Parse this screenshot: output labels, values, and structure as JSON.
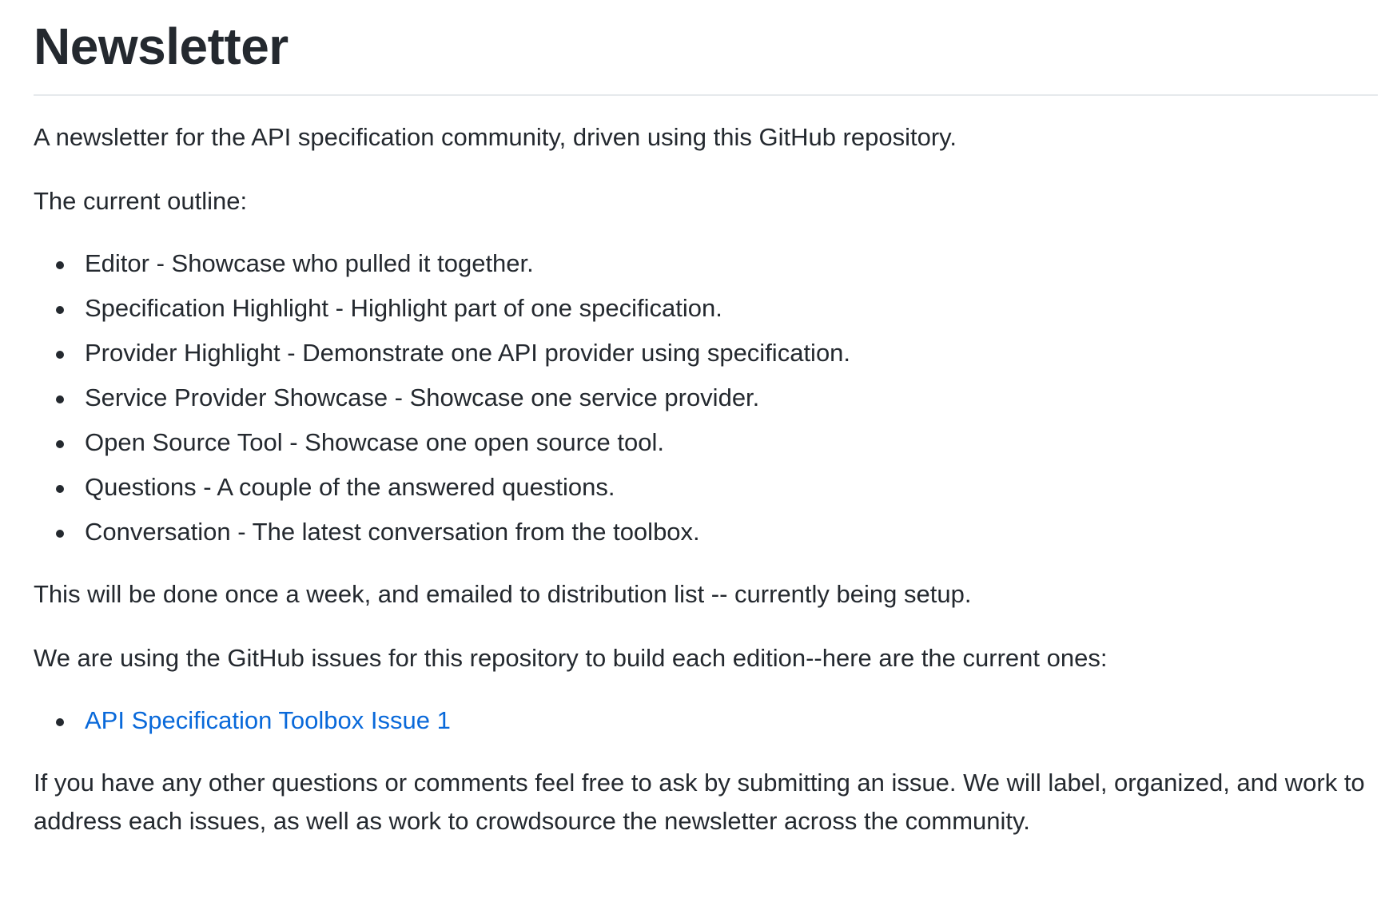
{
  "readme": {
    "title": "Newsletter",
    "intro": "A newsletter for the API specification community, driven using this GitHub repository.",
    "outline_heading": "The current outline:",
    "outline_items": [
      "Editor - Showcase who pulled it together.",
      "Specification Highlight - Highlight part of one specification.",
      "Provider Highlight - Demonstrate one API provider using specification.",
      "Service Provider Showcase - Showcase one service provider.",
      "Open Source Tool - Showcase one open source tool.",
      "Questions - A couple of the answered questions.",
      "Conversation - The latest conversation from the toolbox."
    ],
    "schedule_text": "This will be done once a week, and emailed to distribution list -- currently being setup.",
    "issues_text": "We are using the GitHub issues for this repository to build each edition--here are the current ones:",
    "issue_links": [
      "API Specification Toolbox Issue 1"
    ],
    "closing_text": "If you have any other questions or comments feel free to ask by submitting an issue. We will label, organized, and work to address each issues, as well as work to crowdsource the newsletter across the community.",
    "link_color": "#0969da",
    "text_color": "#24292f"
  }
}
